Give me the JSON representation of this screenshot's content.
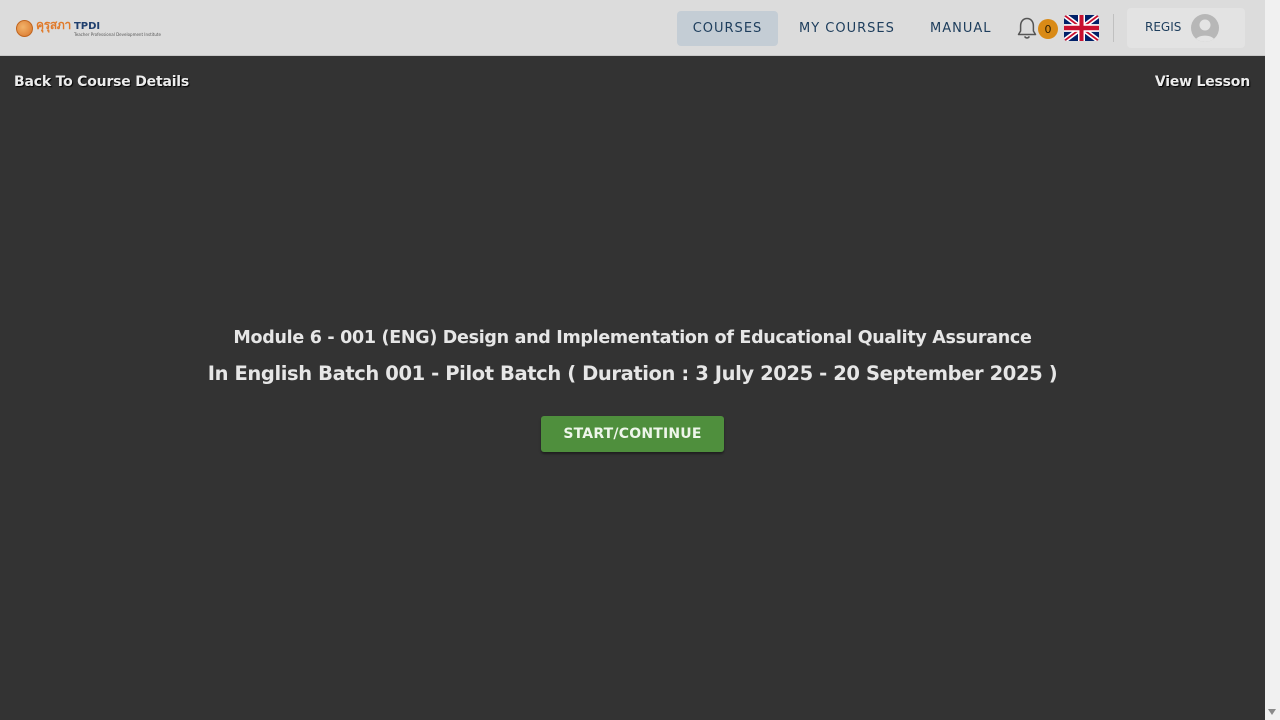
{
  "navbar": {
    "logo": {
      "thai_text": "คุรุสภา",
      "brand": "TPDI",
      "tagline": "Teacher Professional Development Institute"
    },
    "links": [
      {
        "label": "COURSES",
        "active": true
      },
      {
        "label": "MY COURSES",
        "active": false
      },
      {
        "label": "MANUAL",
        "active": false
      }
    ],
    "notifications": {
      "icon": "bell-icon",
      "count": "0"
    },
    "language": {
      "icon": "uk-flag-icon",
      "code": "EN"
    },
    "user": {
      "name": "REGIS",
      "icon": "avatar-icon"
    }
  },
  "page": {
    "back_link": "Back To Course Details",
    "view_lesson_link": "View Lesson",
    "title_line1": "Module 6 - 001 (ENG) Design and Implementation of Educational Quality Assurance",
    "title_line2": "In English Batch 001 - Pilot Batch ( Duration : 3 July 2025 - 20 September 2025 )",
    "start_button": "START/CONTINUE"
  },
  "colors": {
    "navbar_bg": "#dcdcdc",
    "page_bg": "#333333",
    "nav_text": "#1d3d5c",
    "active_tab_bg": "#c4cdd5",
    "badge_bg": "#d98a16",
    "start_button_bg": "#4f8f3d"
  }
}
